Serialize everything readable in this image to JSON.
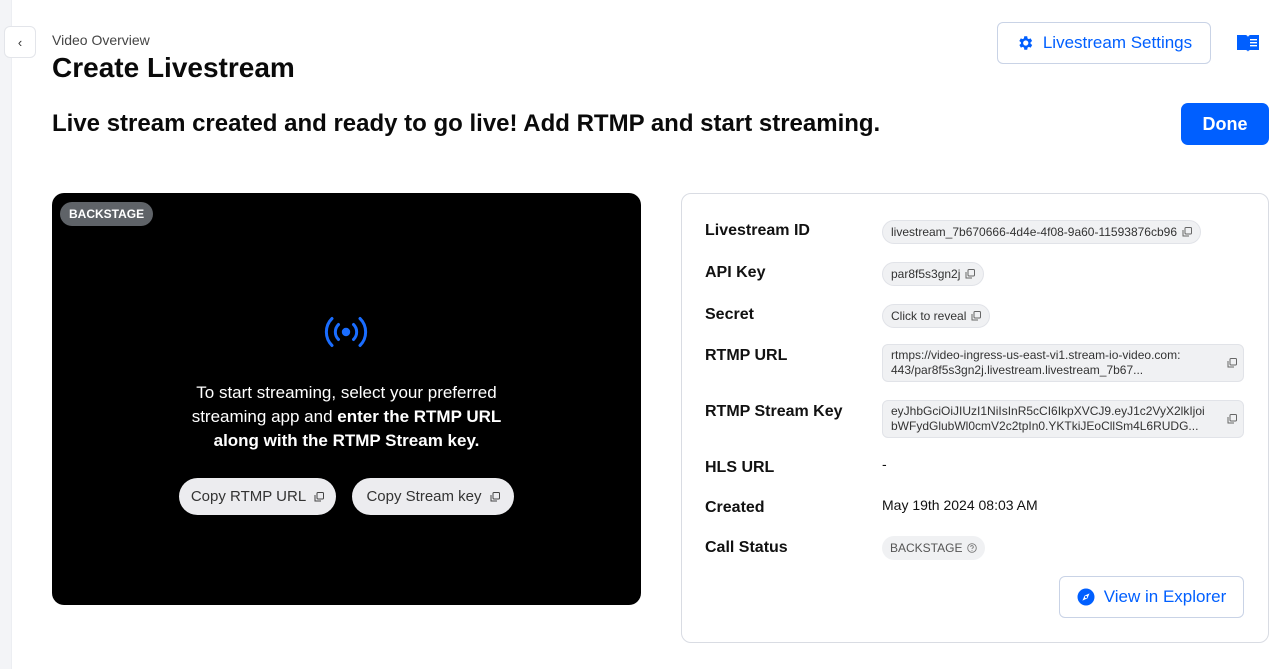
{
  "nav": {
    "back_icon": "chevron-left-icon",
    "back_glyph": "‹"
  },
  "header": {
    "breadcrumb": "Video Overview",
    "title": "Create Livestream",
    "settings_label": "Livestream Settings",
    "settings_icon": "gear-icon",
    "docs_icon": "book-icon"
  },
  "status": {
    "heading": "Live stream created and ready to go live! Add RTMP and start streaming.",
    "done_label": "Done"
  },
  "preview": {
    "badge": "BACKSTAGE",
    "icon": "broadcast-icon",
    "message_part1": "To start streaming, select your preferred streaming app and ",
    "message_bold": "enter the RTMP URL along with the RTMP Stream key.",
    "copy_rtmp_label": "Copy RTMP URL",
    "copy_key_label": "Copy Stream key"
  },
  "details": {
    "livestream_id": {
      "label": "Livestream ID",
      "value": "livestream_7b670666-4d4e-4f08-9a60-11593876cb96"
    },
    "api_key": {
      "label": "API Key",
      "value": "par8f5s3gn2j"
    },
    "secret": {
      "label": "Secret",
      "value": "Click to reveal"
    },
    "rtmp_url": {
      "label": "RTMP URL",
      "line1": "rtmps://video-ingress-us-east-vi1.stream-io-video.com:",
      "line2": "443/par8f5s3gn2j.livestream.livestream_7b67..."
    },
    "rtmp_stream_key": {
      "label": "RTMP Stream Key",
      "line1": "eyJhbGciOiJIUzI1NiIsInR5cCI6IkpXVCJ9.eyJ1c2VyX2lkIjoi",
      "line2": "bWFydGlubWl0cmV2c2tpIn0.YKTkiJEoCllSm4L6RUDG..."
    },
    "hls_url": {
      "label": "HLS URL",
      "value": "-"
    },
    "created": {
      "label": "Created",
      "value": "May 19th 2024 08:03 AM"
    },
    "call_status": {
      "label": "Call Status",
      "value": "BACKSTAGE"
    },
    "explorer_label": "View in Explorer",
    "explorer_icon": "compass-icon"
  },
  "colors": {
    "accent": "#005fff",
    "preview_bg": "#000000",
    "badge_bg": "#5f6368"
  }
}
